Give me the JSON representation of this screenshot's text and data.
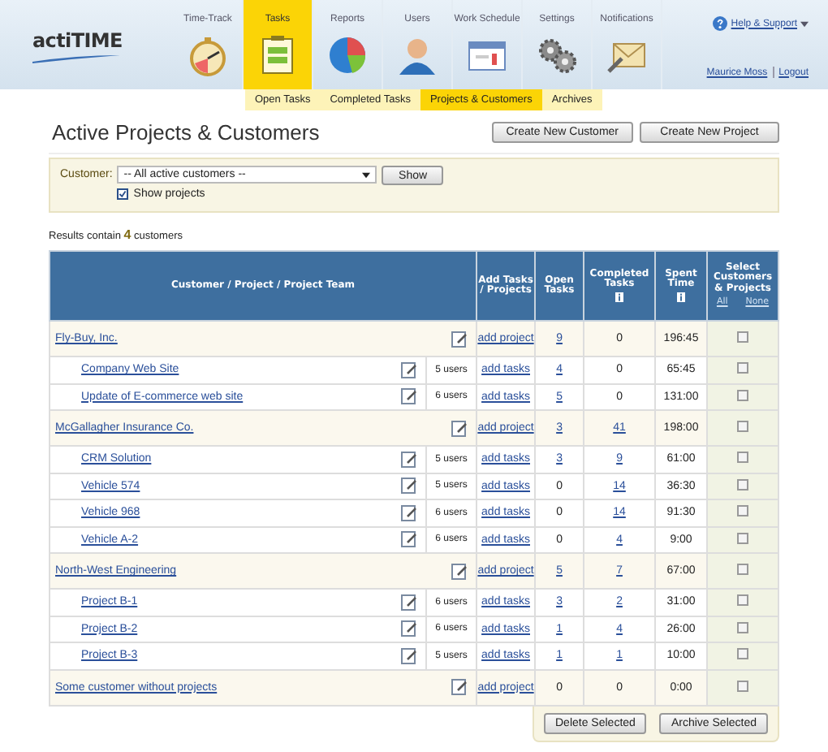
{
  "header": {
    "logo": "actiTIME",
    "nav": [
      {
        "label": "Time-Track",
        "kind": "stopwatch",
        "selected": false
      },
      {
        "label": "Tasks",
        "kind": "clipboard",
        "selected": true
      },
      {
        "label": "Reports",
        "kind": "pie",
        "selected": false
      },
      {
        "label": "Users",
        "kind": "person",
        "selected": false
      },
      {
        "label": "Work Schedule",
        "kind": "calendar",
        "selected": false
      },
      {
        "label": "Settings",
        "kind": "gears",
        "selected": false
      },
      {
        "label": "Notifications",
        "kind": "envelope",
        "selected": false
      }
    ],
    "help": "Help & Support",
    "user": "Maurice Moss",
    "logout": "Logout"
  },
  "subnav": [
    {
      "label": "Open Tasks",
      "selected": false
    },
    {
      "label": "Completed Tasks",
      "selected": false
    },
    {
      "label": "Projects & Customers",
      "selected": true
    },
    {
      "label": "Archives",
      "selected": false
    }
  ],
  "page_title": "Active Projects & Customers",
  "actions": [
    "Create New Customer",
    "Create New Project"
  ],
  "filter": {
    "label": "Customer:",
    "value": "-- All active customers --",
    "button": "Show",
    "show_projects": {
      "label": "Show projects",
      "checked": true
    }
  },
  "results": "Results contain **4** customers",
  "table": {
    "columns": [
      "Customer / Project / Project Team",
      "Add Tasks / Projects",
      "Open Tasks",
      "Completed Tasks",
      "Spent Time",
      "Select Customers & Projects"
    ],
    "select_all": "All",
    "select_none": "None",
    "rows": [
      {
        "kind": "customer",
        "name": "Fly-Buy, Inc.",
        "add": "add project",
        "open": "9",
        "open_linked": true,
        "completed": "0",
        "completed_linked": false,
        "spent": "196:45",
        "selected": false
      },
      {
        "kind": "project",
        "name": "Company Web Site",
        "users": "5 users",
        "add": "add tasks",
        "open": "4",
        "open_linked": true,
        "completed": "0",
        "completed_linked": false,
        "spent": "65:45",
        "selected": false
      },
      {
        "kind": "project",
        "name": "Update of E-commerce web site",
        "users": "6 users",
        "add": "add tasks",
        "open": "5",
        "open_linked": true,
        "completed": "0",
        "completed_linked": false,
        "spent": "131:00",
        "selected": false
      },
      {
        "kind": "customer",
        "name": "McGallagher Insurance Co.",
        "add": "add project",
        "open": "3",
        "open_linked": true,
        "completed": "41",
        "completed_linked": true,
        "spent": "198:00",
        "selected": false
      },
      {
        "kind": "project",
        "name": "CRM Solution",
        "users": "5 users",
        "add": "add tasks",
        "open": "3",
        "open_linked": true,
        "completed": "9",
        "completed_linked": true,
        "spent": "61:00",
        "selected": false
      },
      {
        "kind": "project",
        "name": "Vehicle 574",
        "users": "5 users",
        "add": "add tasks",
        "open": "0",
        "open_linked": false,
        "completed": "14",
        "completed_linked": true,
        "spent": "36:30",
        "selected": false
      },
      {
        "kind": "project",
        "name": "Vehicle 968",
        "users": "6 users",
        "add": "add tasks",
        "open": "0",
        "open_linked": false,
        "completed": "14",
        "completed_linked": true,
        "spent": "91:30",
        "selected": false
      },
      {
        "kind": "project",
        "name": "Vehicle A-2",
        "users": "6 users",
        "add": "add tasks",
        "open": "0",
        "open_linked": false,
        "completed": "4",
        "completed_linked": true,
        "spent": "9:00",
        "selected": false
      },
      {
        "kind": "customer",
        "name": "North-West Engineering",
        "add": "add project",
        "open": "5",
        "open_linked": true,
        "completed": "7",
        "completed_linked": true,
        "spent": "67:00",
        "selected": false
      },
      {
        "kind": "project",
        "name": "Project B-1",
        "users": "6 users",
        "add": "add tasks",
        "open": "3",
        "open_linked": true,
        "completed": "2",
        "completed_linked": true,
        "spent": "31:00",
        "selected": false
      },
      {
        "kind": "project",
        "name": "Project B-2",
        "users": "6 users",
        "add": "add tasks",
        "open": "1",
        "open_linked": true,
        "completed": "4",
        "completed_linked": true,
        "spent": "26:00",
        "selected": false
      },
      {
        "kind": "project",
        "name": "Project B-3",
        "users": "5 users",
        "add": "add tasks",
        "open": "1",
        "open_linked": true,
        "completed": "1",
        "completed_linked": true,
        "spent": "10:00",
        "selected": false
      },
      {
        "kind": "customer",
        "name": "Some customer without projects",
        "add": "add project",
        "open": "0",
        "open_linked": false,
        "completed": "0",
        "completed_linked": false,
        "spent": "0:00",
        "selected": false
      }
    ]
  },
  "bottom_actions": [
    "Delete Selected",
    "Archive Selected"
  ]
}
